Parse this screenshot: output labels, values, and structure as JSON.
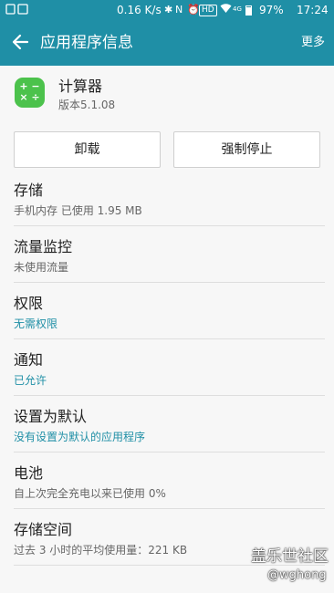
{
  "status_bar": {
    "net_speed": "0.16 K/s",
    "hd_label": "HD",
    "signal_label": "4G",
    "battery": "97%",
    "time": "17:24"
  },
  "app_bar": {
    "title": "应用程序信息",
    "more": "更多"
  },
  "app": {
    "icon_glyph_top": "+ −",
    "icon_glyph_bottom": "× ÷",
    "name": "计算器",
    "version": "版本5.1.08"
  },
  "buttons": {
    "uninstall": "卸载",
    "force_stop": "强制停止"
  },
  "items": [
    {
      "name": "存储",
      "sub": "手机内存 已使用 1.95 MB"
    },
    {
      "name": "流量监控",
      "sub": "未使用流量"
    },
    {
      "name": "权限",
      "sub": "无需权限"
    },
    {
      "name": "通知",
      "sub": "已允许"
    },
    {
      "name": "设置为默认",
      "sub": "没有设置为默认的应用程序"
    },
    {
      "name": "电池",
      "sub": "自上次完全充电以来已使用 0%"
    },
    {
      "name": "存储空间",
      "sub": "过去 3 小时的平均使用量：221 KB"
    }
  ],
  "watermark": {
    "site": "盖乐世社区",
    "user": "@wghong"
  },
  "colors": {
    "accent": "#1f8fa6",
    "app_icon": "#4cc24c"
  }
}
